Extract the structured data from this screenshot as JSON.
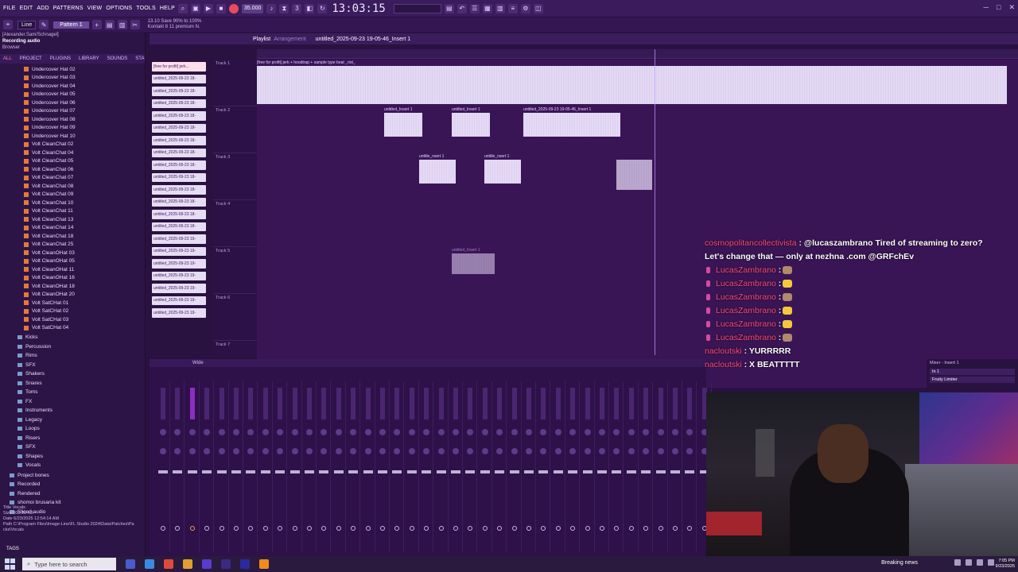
{
  "app": {
    "menu": [
      "FILE",
      "EDIT",
      "ADD",
      "PATTERNS",
      "VIEW",
      "OPTIONS",
      "TOOLS",
      "HELP"
    ],
    "clock": "13:03:15",
    "tempo": "35.000",
    "snap": "Line",
    "pattern": "Pattern 1",
    "cpu_info": [
      "13.10 Save 90% to 100%",
      "Kontakt 8 11 premium N."
    ],
    "accent": "#7a3aa8",
    "record_color": "#e94b5a"
  },
  "browser": {
    "status_top": "[Alexander.Sam/Schnagel]",
    "status_rec": "Recording audio",
    "title": "Browser",
    "tabs": [
      "ALL",
      "PROJECT",
      "PLUGINS",
      "LIBRARY",
      "SOUNDS",
      "STARRED"
    ],
    "files": [
      "Undercover Hat 02",
      "Undercover Hat 03",
      "Undercover Hat 04",
      "Undercover Hat 05",
      "Undercover Hat 06",
      "Undercover Hat 07",
      "Undercover Hat 08",
      "Undercover Hat 09",
      "Undercover Hat 10",
      "Volt CleanChat 02",
      "Volt CleanChat 04",
      "Volt CleanChat 05",
      "Volt CleanChat 06",
      "Volt CleanChat 07",
      "Volt CleanChat 08",
      "Volt CleanChat 09",
      "Volt CleanChat 10",
      "Volt CleanChat 11",
      "Volt CleanChat 13",
      "Volt CleanChat 14",
      "Volt CleanChat 18",
      "Volt CleanChat 25",
      "Volt CleanOHat 03",
      "Volt CleanOHat 05",
      "Volt CleanOHat 11",
      "Volt CleanOHat 16",
      "Volt CleanOHat 18",
      "Volt CleanOHat 20",
      "Volt SatCHat 01",
      "Volt SatCHat 02",
      "Volt SatCHat 03",
      "Volt SatCHat 04"
    ],
    "folders": [
      "Kicks",
      "Percussion",
      "Rims",
      "SFX",
      "Shakers",
      "Snares",
      "Toms",
      "FX",
      "Instruments",
      "Legacy",
      "Loops",
      "Risers",
      "SFX",
      "Shapes",
      "Vocals"
    ],
    "folders2": [
      "Project bones",
      "Recorded",
      "Rendered",
      "shomoi brusaria kit",
      "Sliced audio"
    ],
    "file_info": [
      "Title   Vocals",
      "Size    900.00 KB",
      "Date    6/23/2025 12:54:14 AM",
      "Path    C:\\Program Files\\Image-Line\\FL Studio 2024\\Data\\Patches\\Pa",
      "           cks\\Vocals"
    ],
    "tags_label": "TAGS"
  },
  "playlist": {
    "title": "Playlist",
    "arrangement": "Arrangement",
    "file": "untitled_2025-09-23 19-05-46_Insert 1",
    "first_clip_title": "[free for profit] jerk + hoodtrap + sample type beat _riot_",
    "clip_pills": [
      "[free for profit] jerk...",
      "untitled_2025-09-23 18-",
      "untitled_2025-09-23 18-",
      "untitled_2025-09-23 18-",
      "untitled_2025-09-23 18-",
      "untitled_2025-09-23 18-",
      "untitled_2025-09-23 18-",
      "untitled_2025-09-23 18-",
      "untitled_2025-09-23 18-",
      "untitled_2025-09-23 18-",
      "untitled_2025-09-23 18-",
      "untitled_2025-09-23 18-",
      "untitled_2025-09-23 18-",
      "untitled_2025-09-23 18-",
      "untitled_2025-09-23 19-",
      "untitled_2025-09-23 19-",
      "untitled_2025-09-23 19-",
      "untitled_2025-09-23 19-",
      "untitled_2025-09-23 19-",
      "untitled_2025-09-23 19-",
      "untitled_2025-09-23 19-"
    ],
    "tracks": [
      "Track 1",
      "Track 2",
      "Track 3",
      "Track 4",
      "Track 5",
      "Track 6",
      "Track 7"
    ],
    "clip_titles": {
      "t2a": "untitled_Insert 1",
      "t2b": "untitled_Insert 1",
      "t2c": "untitled_2025-09-23 19-05-46_Insert 1",
      "t3a": "untitle_nsert 1",
      "t3b": "untitle_nsert 1",
      "t5a": "untitled_Insert 1"
    }
  },
  "chat": {
    "messages": [
      {
        "user": "cosmopolitancollectivista",
        "text": " : @lucaszambrano Tired of streaming to zero?"
      },
      {
        "user": "",
        "text": "Let's change that — only at nezhna .com @GRFchEv"
      },
      {
        "user": "LucasZambrano",
        "text": " :",
        "emote": "cat"
      },
      {
        "user": "LucasZambrano",
        "text": " :",
        "emote": "star"
      },
      {
        "user": "LucasZambrano",
        "text": " :",
        "emote": "cat"
      },
      {
        "user": "LucasZambrano",
        "text": " :",
        "emote": "star"
      },
      {
        "user": "LucasZambrano",
        "text": " :",
        "emote": "star"
      },
      {
        "user": "LucasZambrano",
        "text": " :",
        "emote": "cat"
      },
      {
        "user": "nacloutski",
        "text": " : YURRRRR"
      },
      {
        "user": "nacloutski",
        "text": " : X BEATTTTT"
      }
    ]
  },
  "mixer": {
    "title": "Wide",
    "right_title": "Mixer - Insert 1",
    "slot": "In 1",
    "plugin": "Fruity Limiter"
  },
  "taskbar": {
    "search_placeholder": "Type here to search",
    "news": "Breaking news",
    "time": "7:05 PM",
    "date": "9/23/2025"
  }
}
